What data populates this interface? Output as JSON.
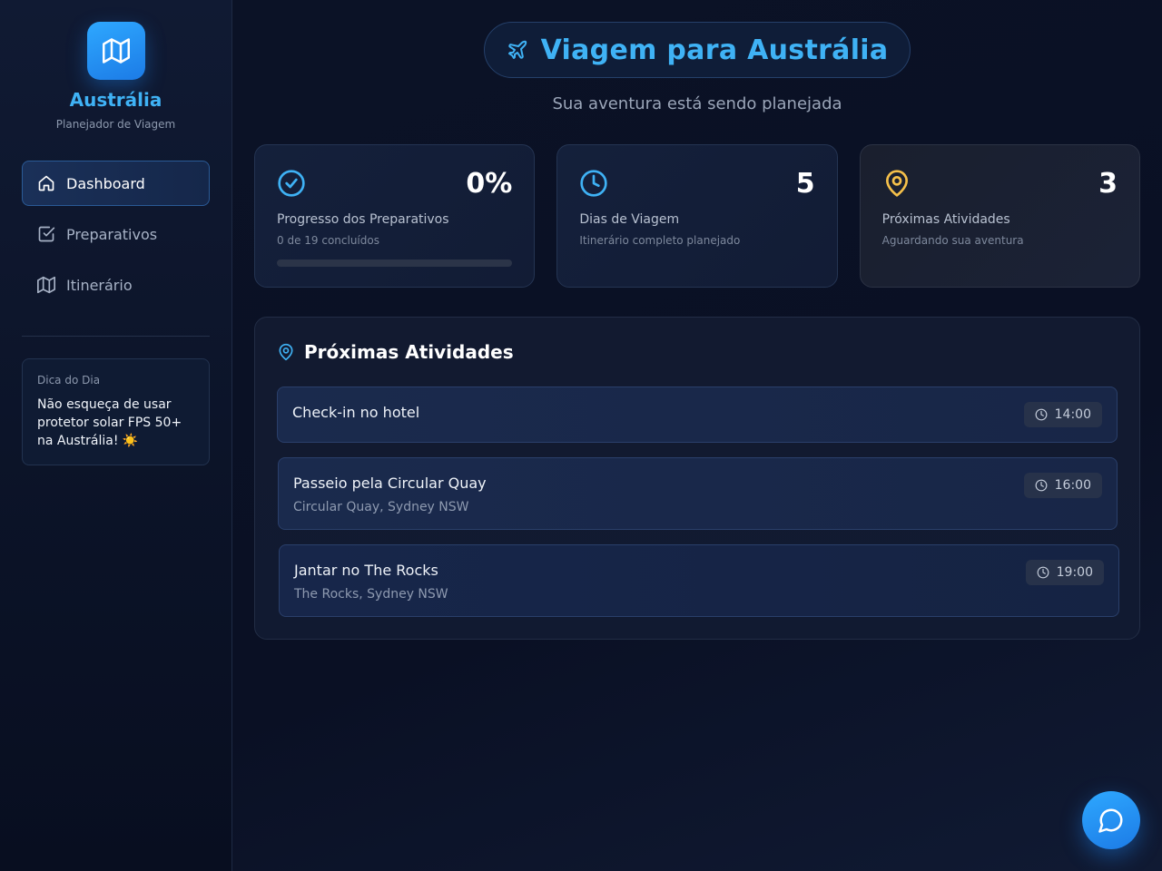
{
  "brand": {
    "title": "Austrália",
    "subtitle": "Planejador de Viagem",
    "icon": "map-icon"
  },
  "nav": {
    "items": [
      {
        "label": "Dashboard",
        "icon": "home-icon",
        "active": true
      },
      {
        "label": "Preparativos",
        "icon": "checkbox-icon",
        "active": false
      },
      {
        "label": "Itinerário",
        "icon": "map-icon",
        "active": false
      }
    ]
  },
  "tip": {
    "title": "Dica do Dia",
    "text": "Não esqueça de usar protetor solar FPS 50+ na Austrália! ☀️"
  },
  "hero": {
    "title": "Viagem para Austrália",
    "subtitle": "Sua aventura está sendo planejada",
    "icon": "plane-icon"
  },
  "stats": [
    {
      "value": "0%",
      "label": "Progresso dos Preparativos",
      "desc": "0 de 19 concluídos",
      "icon": "check-circle-icon",
      "color": "#3fb2f5",
      "progress": 0
    },
    {
      "value": "5",
      "label": "Dias de Viagem",
      "desc": "Itinerário completo planejado",
      "icon": "clock-icon",
      "color": "#3fb2f5"
    },
    {
      "value": "3",
      "label": "Próximas Atividades",
      "desc": "Aguardando sua aventura",
      "icon": "map-pin-icon",
      "color": "#f5c04a"
    }
  ],
  "activities": {
    "title": "Próximas Atividades",
    "items": [
      {
        "name": "Check-in no hotel",
        "location": "",
        "time": "14:00"
      },
      {
        "name": "Passeio pela Circular Quay",
        "location": "Circular Quay, Sydney NSW",
        "time": "16:00"
      },
      {
        "name": "Jantar no The Rocks",
        "location": "The Rocks, Sydney NSW",
        "time": "19:00"
      }
    ]
  },
  "colors": {
    "accent": "#3fb2f5",
    "warning": "#f5c04a",
    "background": "#0b1226"
  },
  "chat": {
    "icon": "chat-icon"
  }
}
